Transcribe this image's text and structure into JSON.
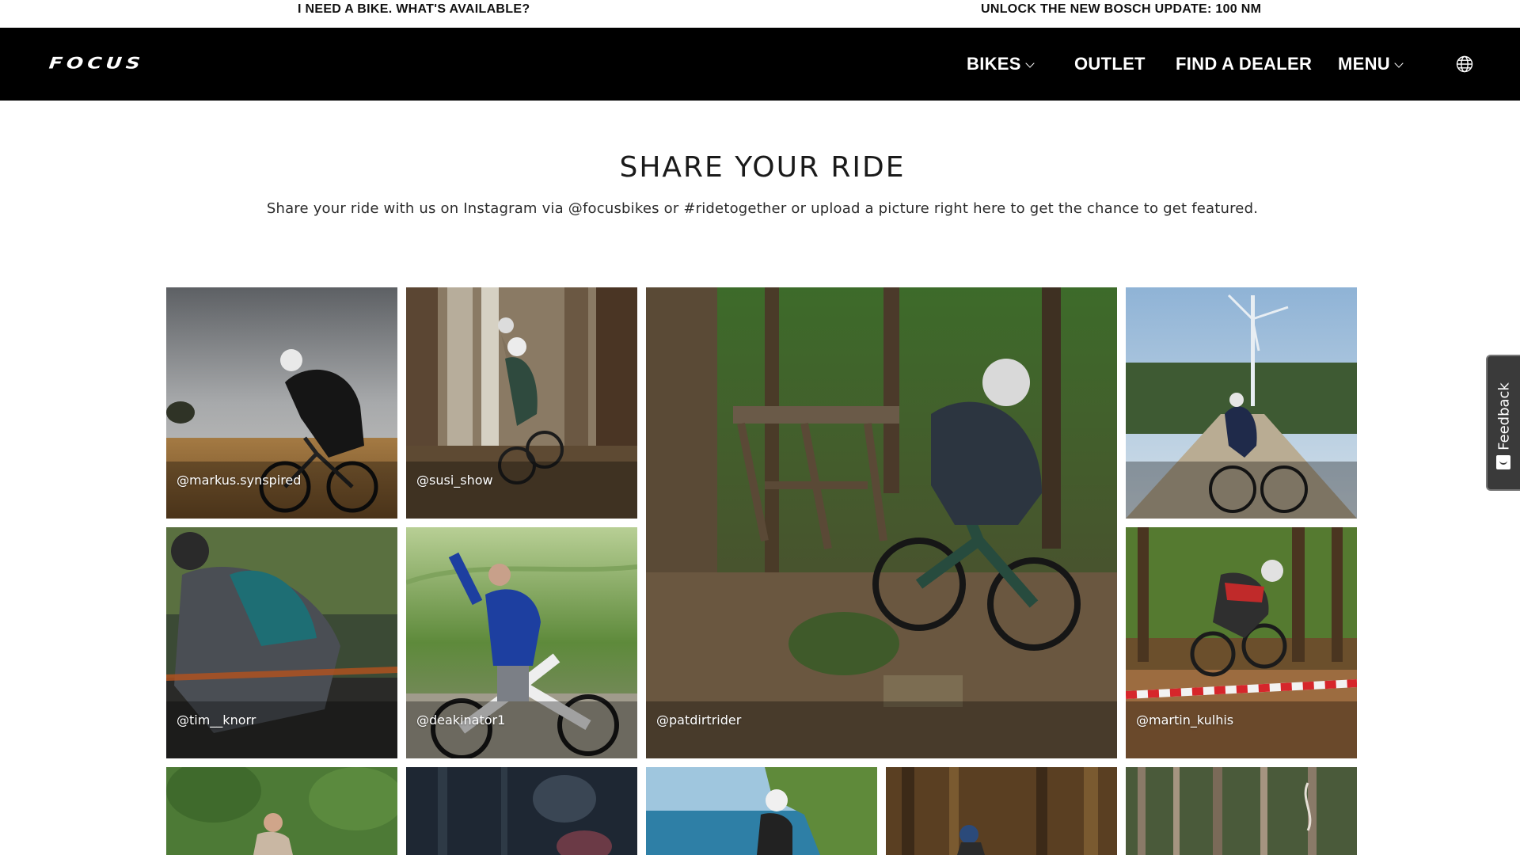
{
  "promo": {
    "left_link": "I NEED A BIKE. WHAT'S AVAILABLE?",
    "right_link": "UNLOCK THE NEW BOSCH UPDATE: 100 NM"
  },
  "nav": {
    "logo": "FOCUS",
    "items": [
      {
        "label": "BIKES",
        "dropdown": true
      },
      {
        "label": "OUTLET",
        "dropdown": false
      },
      {
        "label": "FIND A DEALER",
        "dropdown": false
      },
      {
        "label": "MENU",
        "dropdown": true
      }
    ],
    "language_icon": "globe-icon"
  },
  "section": {
    "title": "SHARE YOUR RIDE",
    "subtitle": "Share your ride with us on Instagram via @focusbikes or #ridetogether or upload a picture right here to get the chance to get featured."
  },
  "gallery": {
    "tiles": [
      {
        "handle": "@markus.synspired",
        "scene": "cyclist on gravel bike in wheat field under stormy sky"
      },
      {
        "handle": "@susi_show",
        "scene": "two riders on forest trail"
      },
      {
        "handle": "@patdirtrider",
        "scene": "enduro rider on forest trail by wooden ramp"
      },
      {
        "handle": "",
        "scene": "rider on gravel road with wind turbines"
      },
      {
        "handle": "@tim__knorr",
        "scene": "blurred rider in motion"
      },
      {
        "handle": "@deakinator1",
        "scene": "rider posing with e-bike on hillside"
      },
      {
        "handle": "@martin_kulhis",
        "scene": "rider cornering past tape on dirt trail"
      },
      {
        "handle": "",
        "scene": "rider among trees"
      },
      {
        "handle": "",
        "scene": "dark forest scene"
      },
      {
        "handle": "",
        "scene": "rider at coastline"
      },
      {
        "handle": "",
        "scene": "rider in forest"
      },
      {
        "handle": "",
        "scene": "tall pine forest"
      }
    ]
  },
  "feedback": {
    "label": "Feedback"
  },
  "colors": {
    "nav_bg": "#000000",
    "page_bg": "#ffffff",
    "text": "#1a1a1a",
    "feedback_bg": "#3a3a3a"
  }
}
